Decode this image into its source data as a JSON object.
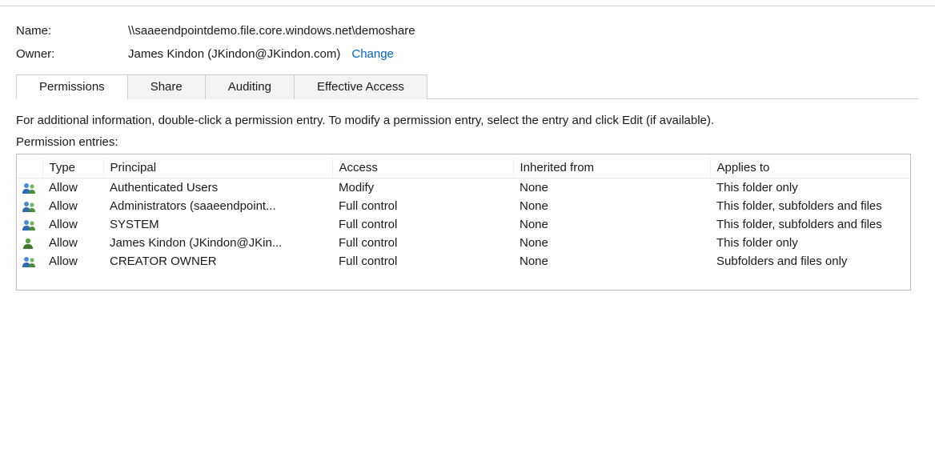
{
  "header": {
    "name_label": "Name:",
    "name_value": "\\\\saaeendpointdemo.file.core.windows.net\\demoshare",
    "owner_label": "Owner:",
    "owner_value": "James Kindon (JKindon@JKindon.com)",
    "change_link": "Change"
  },
  "tabs": {
    "items": [
      {
        "label": "Permissions",
        "active": true
      },
      {
        "label": "Share",
        "active": false
      },
      {
        "label": "Auditing",
        "active": false
      },
      {
        "label": "Effective Access",
        "active": false
      }
    ]
  },
  "instruction": "For additional information, double-click a permission entry. To modify a permission entry, select the entry and click Edit (if available).",
  "subheading": "Permission entries:",
  "table": {
    "headers": {
      "icon": "",
      "type": "Type",
      "principal": "Principal",
      "access": "Access",
      "inherited": "Inherited from",
      "applies": "Applies to"
    },
    "rows": [
      {
        "icon": "group",
        "type": "Allow",
        "principal": "Authenticated Users",
        "access": "Modify",
        "inherited": "None",
        "applies": "This folder only"
      },
      {
        "icon": "group",
        "type": "Allow",
        "principal": "Administrators (saaeendpoint...",
        "access": "Full control",
        "inherited": "None",
        "applies": "This folder, subfolders and files"
      },
      {
        "icon": "group",
        "type": "Allow",
        "principal": "SYSTEM",
        "access": "Full control",
        "inherited": "None",
        "applies": "This folder, subfolders and files"
      },
      {
        "icon": "user",
        "type": "Allow",
        "principal": "James Kindon (JKindon@JKin...",
        "access": "Full control",
        "inherited": "None",
        "applies": "This folder only"
      },
      {
        "icon": "group",
        "type": "Allow",
        "principal": "CREATOR OWNER",
        "access": "Full control",
        "inherited": "None",
        "applies": "Subfolders and files only"
      }
    ]
  }
}
